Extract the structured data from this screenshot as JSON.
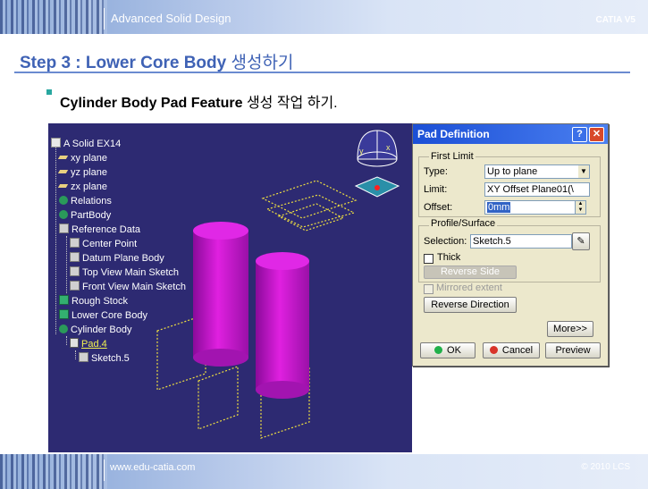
{
  "header": {
    "title": "Advanced Solid Design",
    "brand": "CATIA V5"
  },
  "slide": {
    "heading": "Step 3 : Lower Core Body",
    "heading_kr": "생성하기",
    "subtitle": "Cylinder Body Pad Feature",
    "subtitle_kr": "생성 작업 하기."
  },
  "tree": {
    "items": [
      {
        "label": "A Solid EX14"
      },
      {
        "label": "xy plane"
      },
      {
        "label": "yz plane"
      },
      {
        "label": "zx plane"
      },
      {
        "label": "Relations"
      },
      {
        "label": "PartBody"
      },
      {
        "label": "Reference Data"
      },
      {
        "label": "Center Point"
      },
      {
        "label": "Datum Plane Body"
      },
      {
        "label": "Top View Main Sketch"
      },
      {
        "label": "Front View Main Sketch"
      },
      {
        "label": "Rough Stock"
      },
      {
        "label": "Lower Core Body"
      },
      {
        "label": "Cylinder Body"
      },
      {
        "label": "Pad.4"
      },
      {
        "label": "Sketch.5"
      }
    ]
  },
  "compass": {
    "x_label": "x",
    "y_label": "y"
  },
  "dialog": {
    "title": "Pad Definition",
    "help": "?",
    "close": "✕",
    "first_limit": {
      "group": "First Limit",
      "type_label": "Type:",
      "type_value": "Up to plane",
      "limit_label": "Limit:",
      "limit_value": "XY Offset Plane01(\\",
      "offset_label": "Offset:",
      "offset_value": "0mm"
    },
    "profile": {
      "group": "Profile/Surface",
      "selection_label": "Selection:",
      "selection_value": "Sketch.5",
      "thick_label": "Thick",
      "reverse_side": "Reverse Side"
    },
    "mirrored_extent": "Mirrored extent",
    "reverse_direction": "Reverse Direction",
    "more": "More>>",
    "ok": "OK",
    "cancel": "Cancel",
    "preview": "Preview"
  },
  "footer": {
    "url": "www.edu-catia.com",
    "copyright": "© 2010 LCS"
  },
  "colors": {
    "viewport_bg": "#2d2a72",
    "cylinder": "#cc11cc",
    "accent": "#3f62b5",
    "dialog_bg": "#ece8cc"
  }
}
